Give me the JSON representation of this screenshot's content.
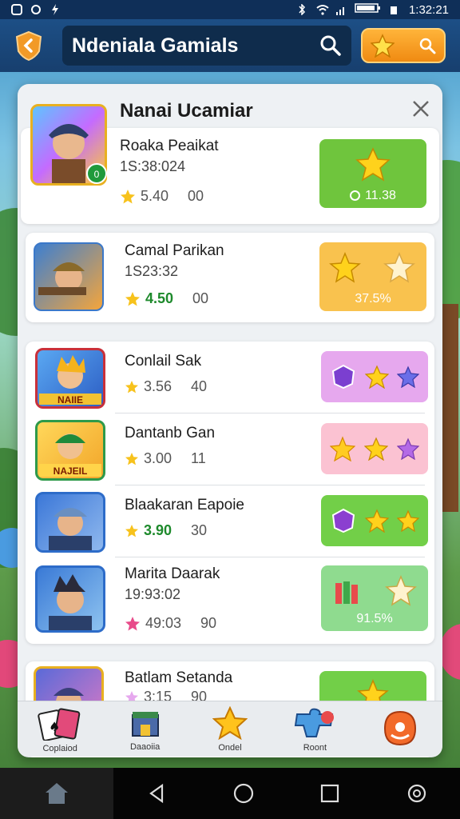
{
  "status_bar": {
    "time": "1:32:21"
  },
  "app_bar": {
    "title": "Ndeniala Gamials"
  },
  "panel": {
    "title": "Nanai Ucamiar"
  },
  "featured": {
    "name": "Roaka Peaikat",
    "time": "1S:38:024",
    "rating": "5.40",
    "count": "00",
    "badge": "0",
    "reward_value": "11.38",
    "reward_color": "#6fc53d"
  },
  "second": {
    "name": "Camal Parikan",
    "time": "1S23:32",
    "rating": "4.50",
    "count": "00",
    "reward_value": "37.5%",
    "reward_color": "#f9c24e"
  },
  "list": [
    {
      "name": "Conlail Sak",
      "rating": "3.56",
      "count": "40",
      "avatar_label": "NAIIE",
      "reward_color": "#e6a8ee"
    },
    {
      "name": "Dantanb Gan",
      "rating": "3.00",
      "count": "11",
      "avatar_label": "NAJEIL",
      "reward_color": "#fbc2d2"
    },
    {
      "name": "Blaakaran Eapoie",
      "rating": "3.90",
      "count": "30",
      "reward_color": "#72cf48"
    },
    {
      "name": "Marita Daarak",
      "time": "19:93:02",
      "rating": "49:03",
      "count": "90",
      "reward_value": "91.5%",
      "reward_color": "#8fdb8f"
    }
  ],
  "partial": {
    "name": "Batlam Setanda",
    "rating": "3:15",
    "count": "90"
  },
  "bottom_nav": [
    {
      "label": "Coplaiod",
      "icon": "cards-icon"
    },
    {
      "label": "Daaoiia",
      "icon": "shop-icon"
    },
    {
      "label": "Ondel",
      "icon": "star-icon"
    },
    {
      "label": "Roont",
      "icon": "puzzle-icon"
    },
    {
      "label": "",
      "icon": "profile-icon"
    }
  ],
  "colors": {
    "accent": "#f39a1e",
    "appbar": "#1d4f86"
  }
}
